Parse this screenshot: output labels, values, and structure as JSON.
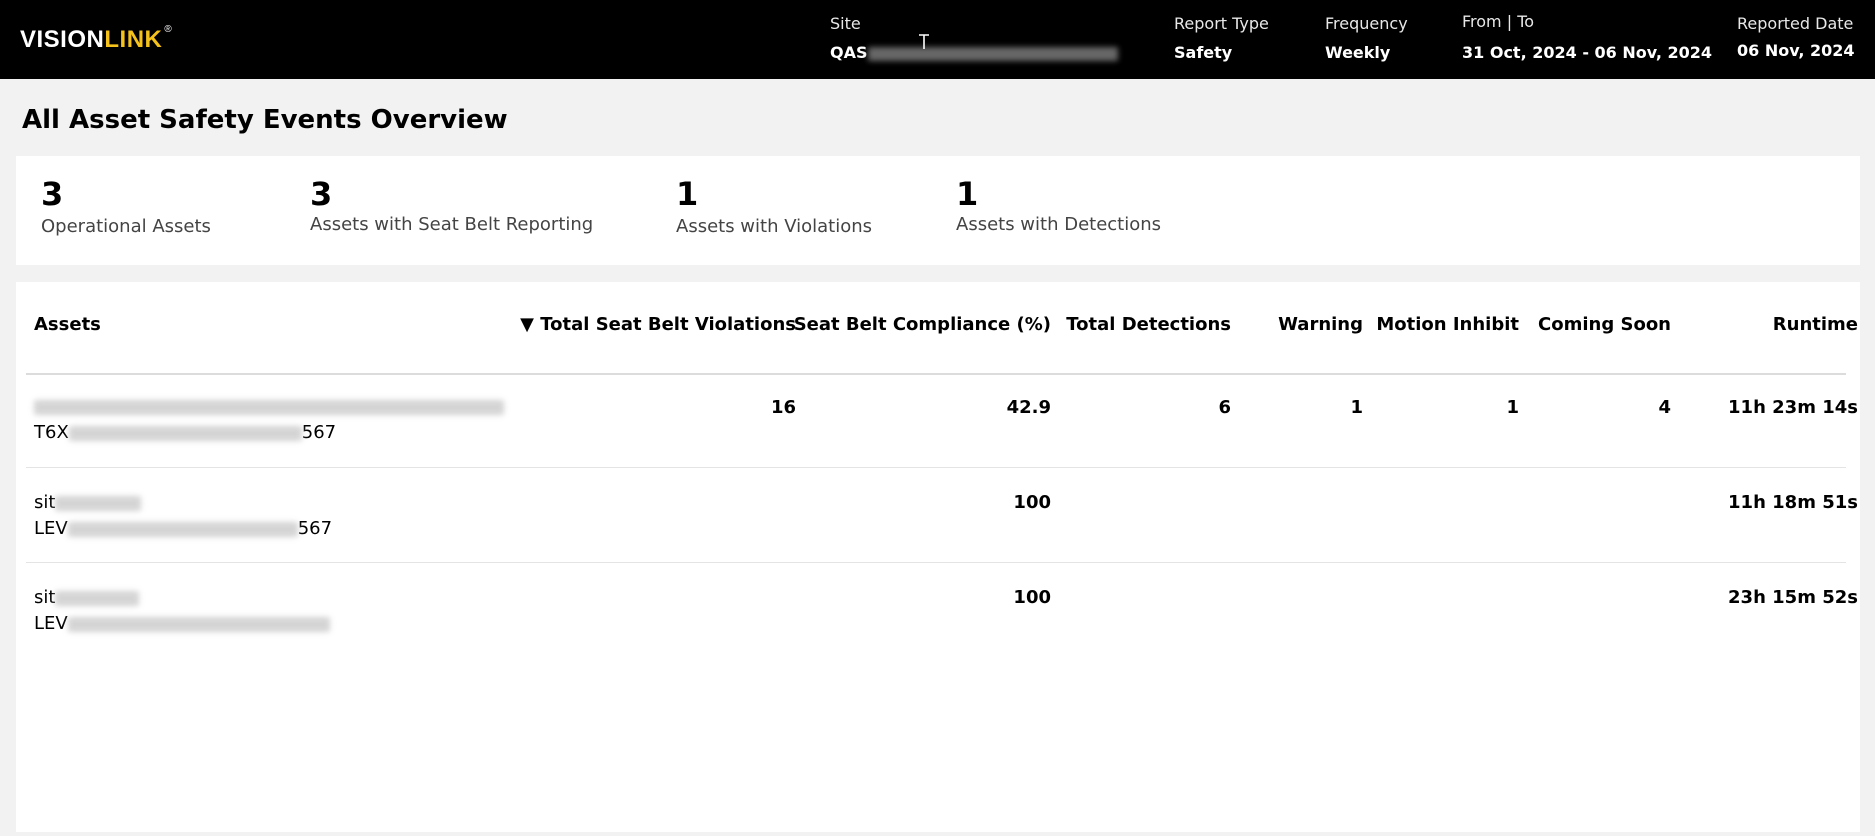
{
  "header": {
    "logo_text_a": "VISION",
    "logo_text_b": "LINK",
    "logo_mark": "®",
    "site_label": "Site",
    "site_value_prefix": "QAS",
    "report_type_label": "Report Type",
    "report_type_value": "Safety",
    "frequency_label": "Frequency",
    "frequency_value": "Weekly",
    "from_to_label": "From | To",
    "from_to_value": "31 Oct, 2024 - 06 Nov, 2024",
    "reported_date_label": "Reported Date",
    "reported_date_value": "06 Nov, 2024"
  },
  "page": {
    "title": "All Asset Safety Events Overview"
  },
  "summary": {
    "stats": [
      {
        "value": "3",
        "label": "Operational Assets"
      },
      {
        "value": "3",
        "label": "Assets with Seat Belt Reporting"
      },
      {
        "value": "1",
        "label": "Assets with Violations"
      },
      {
        "value": "1",
        "label": "Assets with Detections"
      }
    ]
  },
  "table": {
    "columns": {
      "assets": "Assets",
      "violations": "▼ Total Seat Belt Violations",
      "compliance": "Seat Belt Compliance (%)",
      "detections": "Total Detections",
      "warning": "Warning",
      "motion_inhibit": "Motion Inhibit",
      "coming_soon": "Coming Soon",
      "runtime": "Runtime"
    },
    "rows": [
      {
        "name_line1": "",
        "name_line2_prefix": "T6X",
        "name_line2_suffix": "567",
        "violations": "16",
        "compliance": "42.9",
        "detections": "6",
        "warning": "1",
        "motion_inhibit": "1",
        "coming_soon": "4",
        "runtime": "11h 23m 14s"
      },
      {
        "name_line1": "sit",
        "name_line2_prefix": "LEV",
        "name_line2_suffix": "567",
        "violations": "",
        "compliance": "100",
        "detections": "",
        "warning": "",
        "motion_inhibit": "",
        "coming_soon": "",
        "runtime": "11h 18m 51s"
      },
      {
        "name_line1": "sit",
        "name_line2_prefix": "LEV",
        "name_line2_suffix": "",
        "violations": "",
        "compliance": "100",
        "detections": "",
        "warning": "",
        "motion_inhibit": "",
        "coming_soon": "",
        "runtime": "23h 15m 52s"
      }
    ]
  },
  "colors": {
    "header_bg": "#000000",
    "logo_accent": "#f4c21b",
    "page_bg": "#f2f2f2",
    "card_bg": "#ffffff"
  },
  "icons": {
    "cursor": "text-cursor-icon"
  }
}
